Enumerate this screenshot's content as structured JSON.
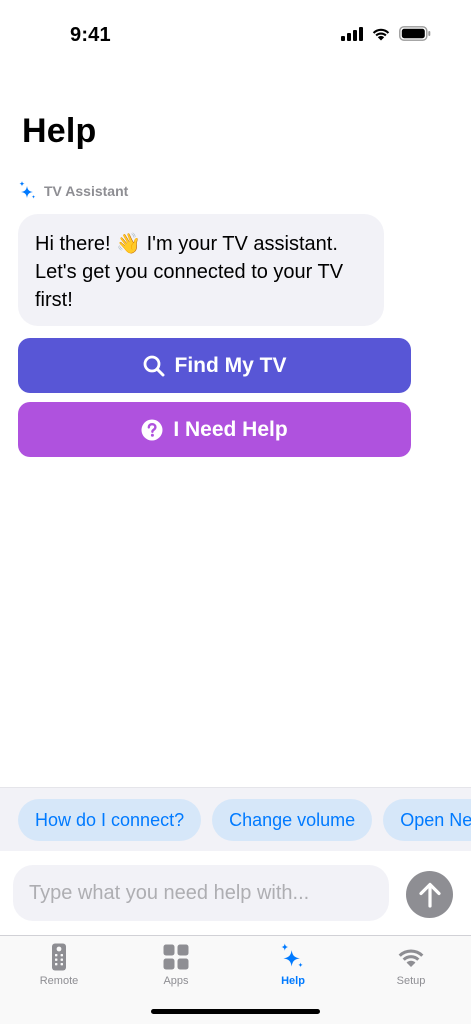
{
  "status_bar": {
    "time": "9:41",
    "icons": [
      "signal-icon",
      "wifi-icon",
      "battery-icon"
    ]
  },
  "page": {
    "title": "Help"
  },
  "assistant": {
    "label": "TV Assistant",
    "icon": "sparkles-icon",
    "message": "Hi there! 👋 I'm your TV assistant. Let's get you connected to your TV first!"
  },
  "actions": {
    "find_tv": {
      "label": "Find My TV",
      "icon": "search-icon",
      "color": "#5856d6"
    },
    "need_help": {
      "label": "I Need Help",
      "icon": "question-circle-icon",
      "color": "#af52de"
    }
  },
  "suggestions": [
    {
      "label": "How do I connect?"
    },
    {
      "label": "Change volume"
    },
    {
      "label": "Open Netflix"
    }
  ],
  "input": {
    "placeholder": "Type what you need help with...",
    "value": "",
    "send_icon": "arrow-up-icon"
  },
  "tab_bar": {
    "tabs": [
      {
        "label": "Remote",
        "icon": "remote-icon",
        "active": false
      },
      {
        "label": "Apps",
        "icon": "apps-grid-icon",
        "active": false
      },
      {
        "label": "Help",
        "icon": "sparkles-icon",
        "active": true
      },
      {
        "label": "Setup",
        "icon": "wifi-icon",
        "active": false
      }
    ]
  },
  "colors": {
    "accent": "#007aff",
    "bubble_bg": "#f2f2f7",
    "chip_bg": "#d6e7f9",
    "inactive": "#8e8e93"
  }
}
